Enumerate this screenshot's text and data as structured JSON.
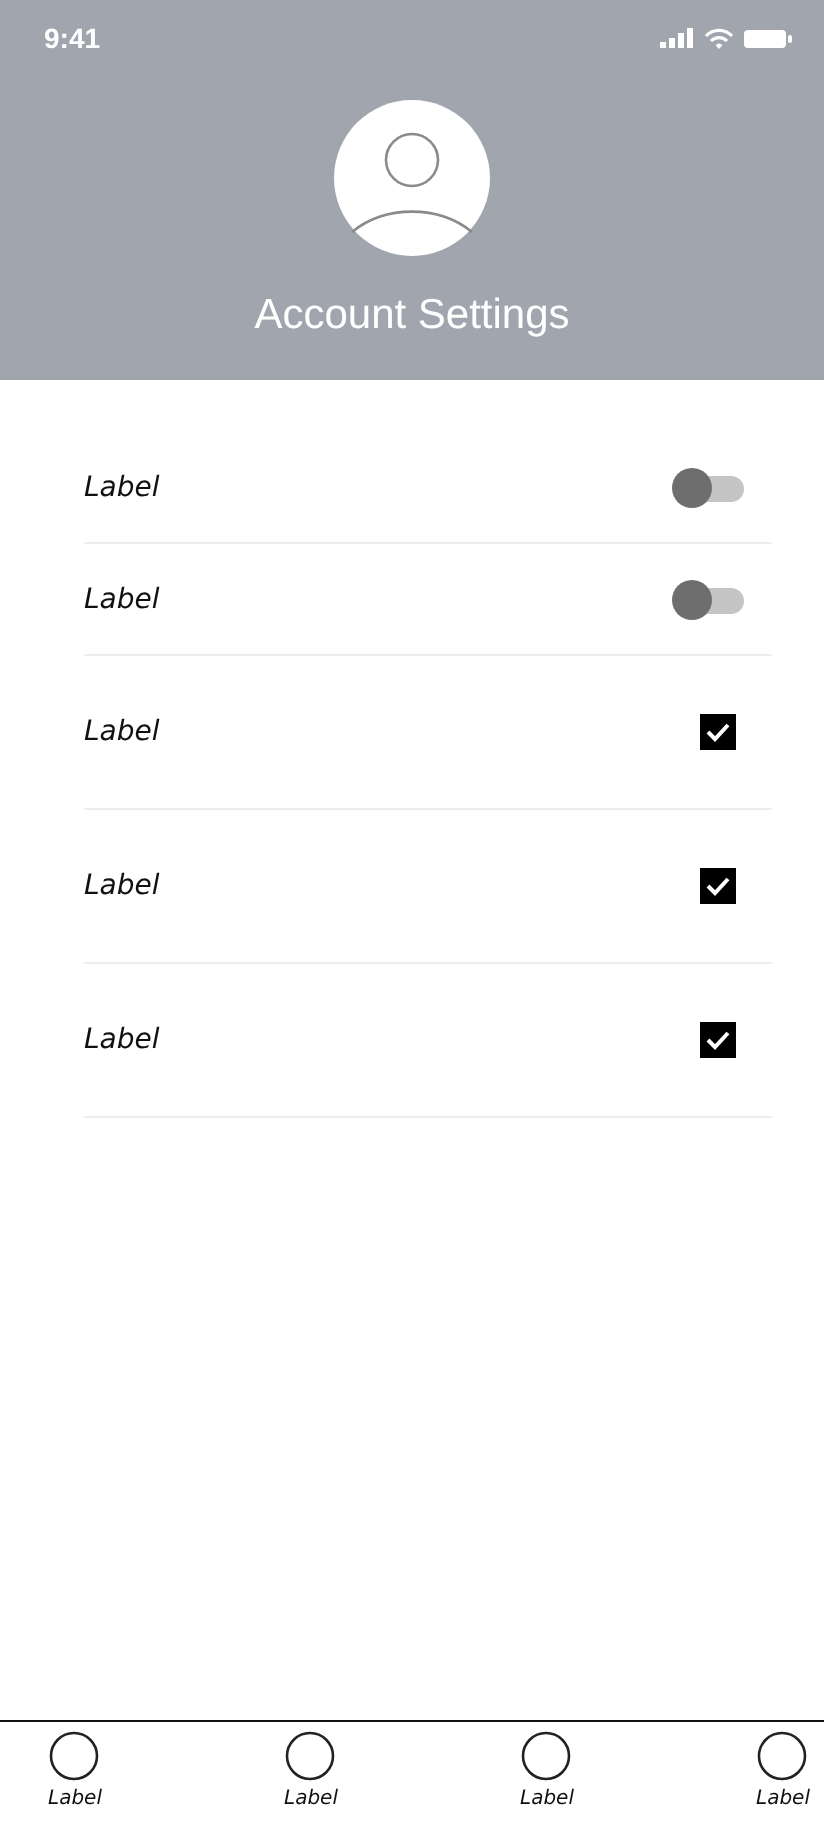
{
  "status_bar": {
    "time": "9:41"
  },
  "header": {
    "title": "Account Settings"
  },
  "settings": [
    {
      "kind": "toggle",
      "label": "Label",
      "on": false
    },
    {
      "kind": "toggle",
      "label": "Label",
      "on": false
    },
    {
      "kind": "checkbox",
      "label": "Label",
      "checked": true
    },
    {
      "kind": "checkbox",
      "label": "Label",
      "checked": true
    },
    {
      "kind": "checkbox",
      "label": "Label",
      "checked": true
    }
  ],
  "tab_bar": [
    {
      "label": "Label"
    },
    {
      "label": "Label"
    },
    {
      "label": "Label"
    },
    {
      "label": "Label"
    }
  ]
}
